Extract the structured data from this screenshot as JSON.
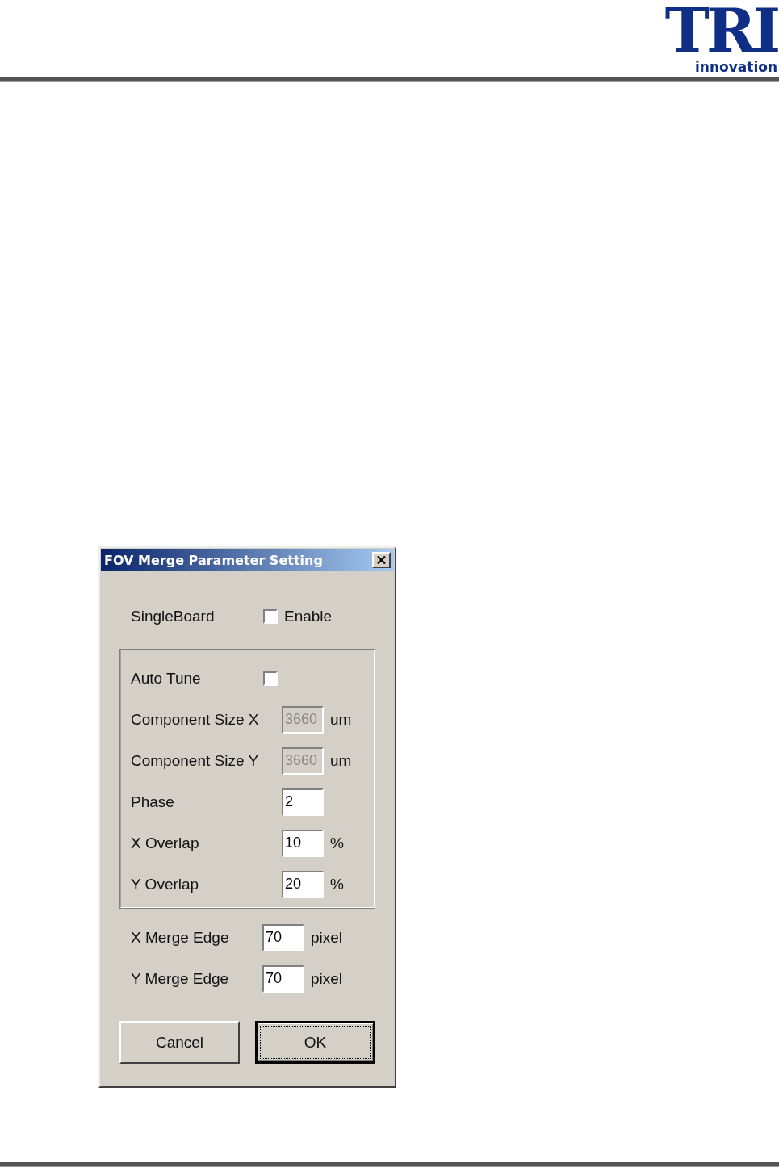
{
  "logo": {
    "mark": "TRI",
    "tagline": "innovation"
  },
  "dialog": {
    "title": "FOV Merge Parameter Setting",
    "single_board": {
      "label": "SingleBoard",
      "checked": false,
      "option": "Enable"
    },
    "group": [
      {
        "kind": "checkbox",
        "label": "Auto Tune",
        "checked": false
      },
      {
        "kind": "field",
        "label": "Component Size X",
        "value": "3660",
        "unit": "um",
        "disabled": true
      },
      {
        "kind": "field",
        "label": "Component Size Y",
        "value": "3660",
        "unit": "um",
        "disabled": true
      },
      {
        "kind": "field",
        "label": "Phase",
        "value": "2",
        "disabled": false
      },
      {
        "kind": "field",
        "label": "X Overlap",
        "value": "10",
        "unit": "%",
        "disabled": false
      },
      {
        "kind": "field",
        "label": "Y Overlap",
        "value": "20",
        "unit": "%",
        "disabled": false
      }
    ],
    "merge": [
      {
        "label": "X Merge Edge",
        "value": "70",
        "unit": "pixel"
      },
      {
        "label": "Y Merge Edge",
        "value": "70",
        "unit": "pixel"
      }
    ],
    "buttons": [
      {
        "label": "Cancel",
        "default": false
      },
      {
        "label": "OK",
        "default": true
      }
    ]
  }
}
